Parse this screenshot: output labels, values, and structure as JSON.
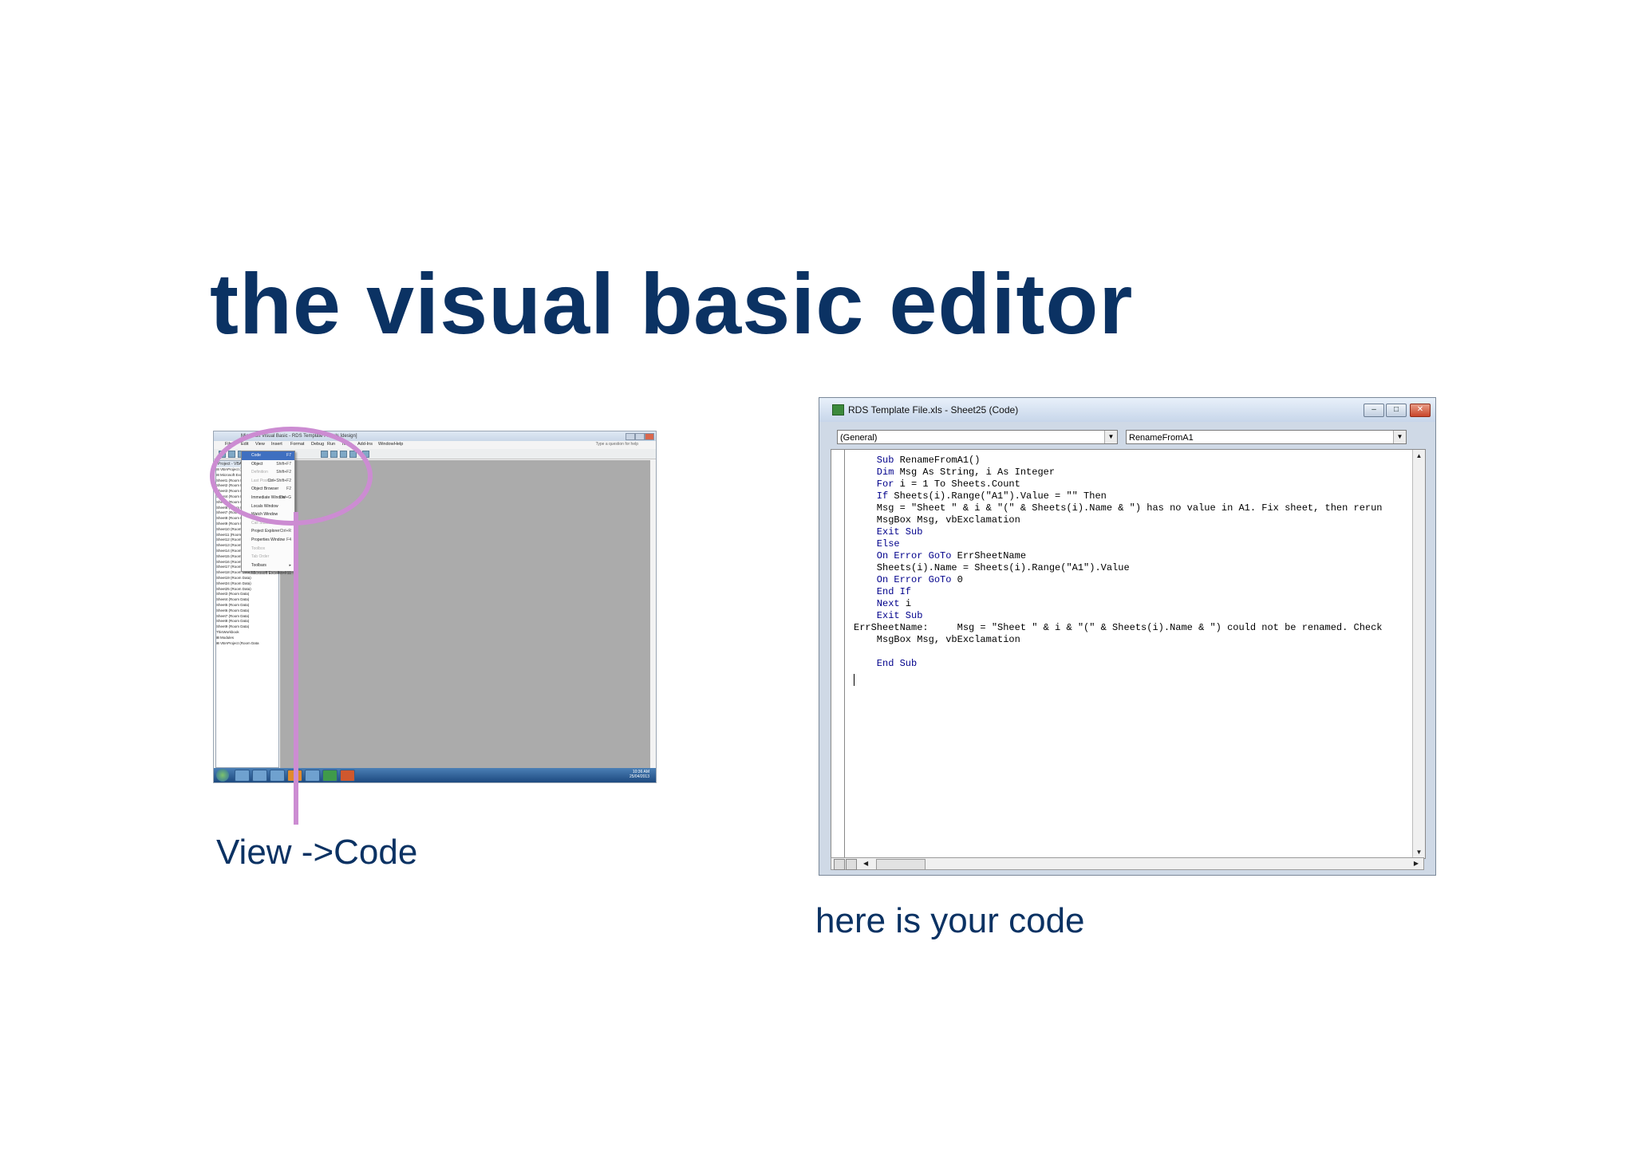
{
  "slide": {
    "title": "the visual basic editor",
    "caption_left": "View ->Code",
    "caption_right": "here is your code"
  },
  "thumbnail": {
    "window_title": "Microsoft Visual Basic - RDS Template File.xls [design]",
    "menu_bar": [
      "File",
      "Edit",
      "View",
      "Insert",
      "Format",
      "Debug",
      "Run",
      "Tools",
      "Add-Ins",
      "Window",
      "Help"
    ],
    "help_box": "Type a question for help",
    "project_panel_title": "Project - VBAProject",
    "view_menu": [
      {
        "label": "Code",
        "shortcut": "F7",
        "state": "selected"
      },
      {
        "label": "Object",
        "shortcut": "Shift+F7",
        "state": "normal"
      },
      {
        "label": "Definition",
        "shortcut": "Shift+F2",
        "state": "disabled"
      },
      {
        "label": "Last Position",
        "shortcut": "Ctrl+Shift+F2",
        "state": "disabled"
      },
      {
        "label": "Object Browser",
        "shortcut": "F2",
        "state": "normal"
      },
      {
        "label": "Immediate Window",
        "shortcut": "Ctrl+G",
        "state": "normal"
      },
      {
        "label": "Locals Window",
        "shortcut": "",
        "state": "normal"
      },
      {
        "label": "Watch Window",
        "shortcut": "",
        "state": "normal"
      },
      {
        "label": "Call Stack...",
        "shortcut": "Ctrl+L",
        "state": "disabled"
      },
      {
        "label": "Project Explorer",
        "shortcut": "Ctrl+R",
        "state": "normal"
      },
      {
        "label": "Properties Window",
        "shortcut": "F4",
        "state": "normal"
      },
      {
        "label": "Toolbox",
        "shortcut": "",
        "state": "disabled"
      },
      {
        "label": "Tab Order",
        "shortcut": "",
        "state": "disabled"
      },
      {
        "label": "Toolbars",
        "shortcut": "▸",
        "state": "normal"
      },
      {
        "label": "Microsoft Excel",
        "shortcut": "Alt+F11",
        "state": "normal"
      }
    ],
    "tree_items": [
      "⊟ VBAProject (RDS Tem",
      "  ⊟ Microsoft Excel",
      "     Sheet1 (Room Data)",
      "     Sheet2 (Room Data)",
      "     Sheet3 (Room Data)",
      "     Sheet4 (Room Data)",
      "     Sheet5 (Room Data)",
      "     Sheet6 (Room Data)",
      "     Sheet7 (Room Data)",
      "     Sheet8 (Room Data)",
      "     Sheet9 (Room Data)",
      "     Sheet10 (Room Data)",
      "     Sheet11 (Room Data)",
      "     Sheet12 (Room Data)",
      "     Sheet13 (Room Data)",
      "     Sheet14 (Room Data)",
      "     Sheet15 (Room Data)",
      "     Sheet16 (Room Data)",
      "     Sheet17 (Room Data)",
      "     Sheet18 (Room Data)",
      "     Sheet19 (Room Data)",
      "     Sheet24 (Room Data)",
      "     Sheet25 (Room Data)",
      "     Sheet3 (Room Data)",
      "     Sheet4 (Room Data)",
      "     Sheet5 (Room Data)",
      "     Sheet6 (Room Data)",
      "     Sheet7 (Room Data)",
      "     Sheet8 (Room Data)",
      "     Sheet9 (Room Data)",
      "     ThisWorkbook",
      "  ⊞ Modules",
      "⊞ VBAProject (Room Data"
    ],
    "clock_time": "10:36 AM",
    "clock_date": "25/04/2013"
  },
  "code_window": {
    "title": "RDS Template File.xls - Sheet25 (Code)",
    "object_combo": "(General)",
    "procedure_combo": "RenameFromA1",
    "buttons": {
      "minimize": "–",
      "maximize": "□",
      "close": "✕"
    },
    "code_lines": [
      {
        "kw": "    Sub ",
        "rest": "RenameFromA1()"
      },
      {
        "kw": "    Dim ",
        "rest": "Msg As String, i As Integer"
      },
      {
        "kw": "    For ",
        "rest": "i = 1 To Sheets.Count"
      },
      {
        "kw": "    If ",
        "rest": "Sheets(i).Range(\"A1\").Value = \"\" Then"
      },
      {
        "kw": "",
        "rest": "    Msg = \"Sheet \" & i & \"(\" & Sheets(i).Name & \") has no value in A1. Fix sheet, then rerun"
      },
      {
        "kw": "",
        "rest": "    MsgBox Msg, vbExclamation"
      },
      {
        "kw": "    Exit Sub",
        "rest": ""
      },
      {
        "kw": "    Else",
        "rest": ""
      },
      {
        "kw": "    On Error GoTo ",
        "rest": "ErrSheetName"
      },
      {
        "kw": "",
        "rest": "    Sheets(i).Name = Sheets(i).Range(\"A1\").Value"
      },
      {
        "kw": "    On Error GoTo ",
        "rest": "0"
      },
      {
        "kw": "    End If",
        "rest": ""
      },
      {
        "kw": "    Next ",
        "rest": "i"
      },
      {
        "kw": "    Exit Sub",
        "rest": ""
      },
      {
        "kw": "",
        "rest": "ErrSheetName:     Msg = \"Sheet \" & i & \"(\" & Sheets(i).Name & \") could not be renamed. Check"
      },
      {
        "kw": "",
        "rest": "    MsgBox Msg, vbExclamation"
      },
      {
        "kw": "",
        "rest": ""
      },
      {
        "kw": "    End Sub",
        "rest": ""
      }
    ]
  }
}
